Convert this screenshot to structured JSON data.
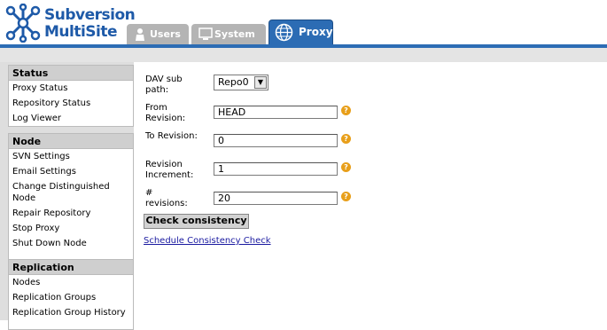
{
  "app": {
    "logo_line1": "Subversion",
    "logo_line2": "MultiSite"
  },
  "tabs": [
    {
      "label": "Users",
      "icon": "user-icon",
      "active": false
    },
    {
      "label": "System",
      "icon": "monitor-icon",
      "active": false
    },
    {
      "label": "Proxy",
      "icon": "globe-icon",
      "active": true
    }
  ],
  "sidebar": {
    "sections": [
      {
        "title": "Status",
        "items": [
          "Proxy Status",
          "Repository Status",
          "Log Viewer"
        ]
      },
      {
        "title": "Node",
        "items": [
          "SVN Settings",
          "Email Settings",
          "Change Distinguished Node",
          "Repair Repository",
          "Stop Proxy",
          "Shut Down Node"
        ]
      },
      {
        "title": "Replication",
        "items": [
          "Nodes",
          "Replication Groups",
          "Replication Group History"
        ]
      }
    ]
  },
  "form": {
    "dav_label": "DAV sub path:",
    "dav_value": "Repo0",
    "from_label": "From Revision:",
    "from_value": "HEAD",
    "to_label": "To Revision:",
    "to_value": "0",
    "increment_label": "Revision Increment:",
    "increment_value": "1",
    "num_label": "# revisions:",
    "num_value": "20",
    "help_glyph": "?",
    "submit_label": "Check consistency",
    "schedule_link": "Schedule Consistency Check"
  },
  "colors": {
    "accent": "#2c6cb4",
    "help": "#e89f1a",
    "link": "#1a1aa0"
  }
}
